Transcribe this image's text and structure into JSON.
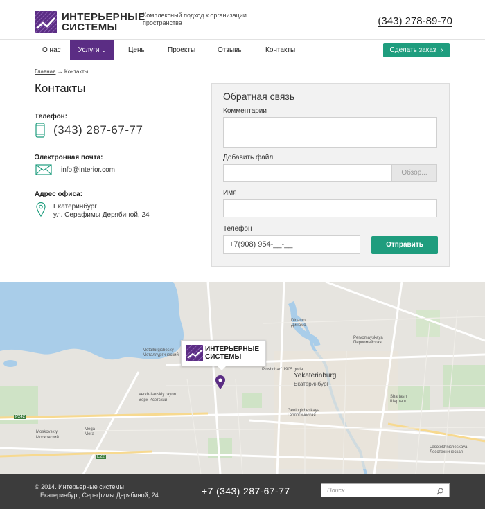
{
  "header": {
    "brand_line1": "ИНТЕРЬЕРНЫЕ",
    "brand_line2": "СИСТЕМЫ",
    "tagline": "Комплексный подход к организации пространства",
    "phone": "(343) 278-89-70"
  },
  "nav": {
    "items": [
      "О нас",
      "Услуги",
      "Цены",
      "Проекты",
      "Отзывы",
      "Контакты"
    ],
    "active": "Услуги",
    "order_button": "Сделать заказ"
  },
  "breadcrumb": {
    "home": "Главная",
    "separator": "→",
    "current": "Контакты"
  },
  "page_title": "Контакты",
  "contacts": {
    "phone_label": "Телефон:",
    "phone": "(343) 287-67-77",
    "email_label": "Электронная почта:",
    "email": "info@interior.com",
    "address_label": "Адрес офиса:",
    "address_city": "Екатеринбург",
    "address_street": "ул. Серафимы Дерябиной, 24"
  },
  "form": {
    "title": "Обратная связь",
    "comments_label": "Комментарии",
    "file_label": "Добавить файл",
    "browse_button": "Обзор...",
    "name_label": "Имя",
    "phone_label": "Телефон",
    "phone_value": "+7(908) 954-__-__",
    "submit_button": "Отправить"
  },
  "map": {
    "callout_line1": "ИНТЕРЬЕРНЫЕ",
    "callout_line2": "СИСТЕМЫ",
    "labels": {
      "yekaterinburg_en": "Yekaterinburg",
      "yekaterinburg_ru": "Екатеринбург",
      "verkh_en": "Verkh-Isetskiy rayon",
      "verkh_ru": "Верх-Исетский",
      "dinamo_en": "Dinamo",
      "dinamo_ru": "Динамо",
      "pervomay_en": "Pervomayskaya",
      "pervomay_ru": "Первомайская",
      "ploshchad": "Ploshchad' 1905 goda",
      "geolog_en": "Geologicheskaya",
      "geolog_ru": "Геологическая",
      "shartash_en": "Shartash",
      "shartash_ru": "Шарташ",
      "mega_en": "Mega",
      "mega_ru": "Мега",
      "moskovsky_en": "Moskovskiy",
      "moskovsky_ru": "Московский",
      "metallurg_en": "Metallurgichesky",
      "metallurg_ru": "Металлургический",
      "lesotekh_en": "Lesotekhnicheskaya",
      "lesotekh_ru": "Лесотехническая",
      "road1": "Р242",
      "road2": "Е22"
    }
  },
  "footer": {
    "copyright": "© 2014. Интерьерные системы",
    "address": "Екатеринбург, Серафимы Дерябиной, 24",
    "phone": "+7 (343) 287-67-77",
    "search_placeholder": "Поиск"
  },
  "colors": {
    "brand": "#5b2d84",
    "accent": "#1f9d7e",
    "footer_bg": "#3c3c3c"
  },
  "icons": {
    "phone": "phone-icon",
    "email": "envelope-icon",
    "address": "location-pin-icon",
    "search": "search-icon",
    "map_marker": "map-marker-icon"
  }
}
